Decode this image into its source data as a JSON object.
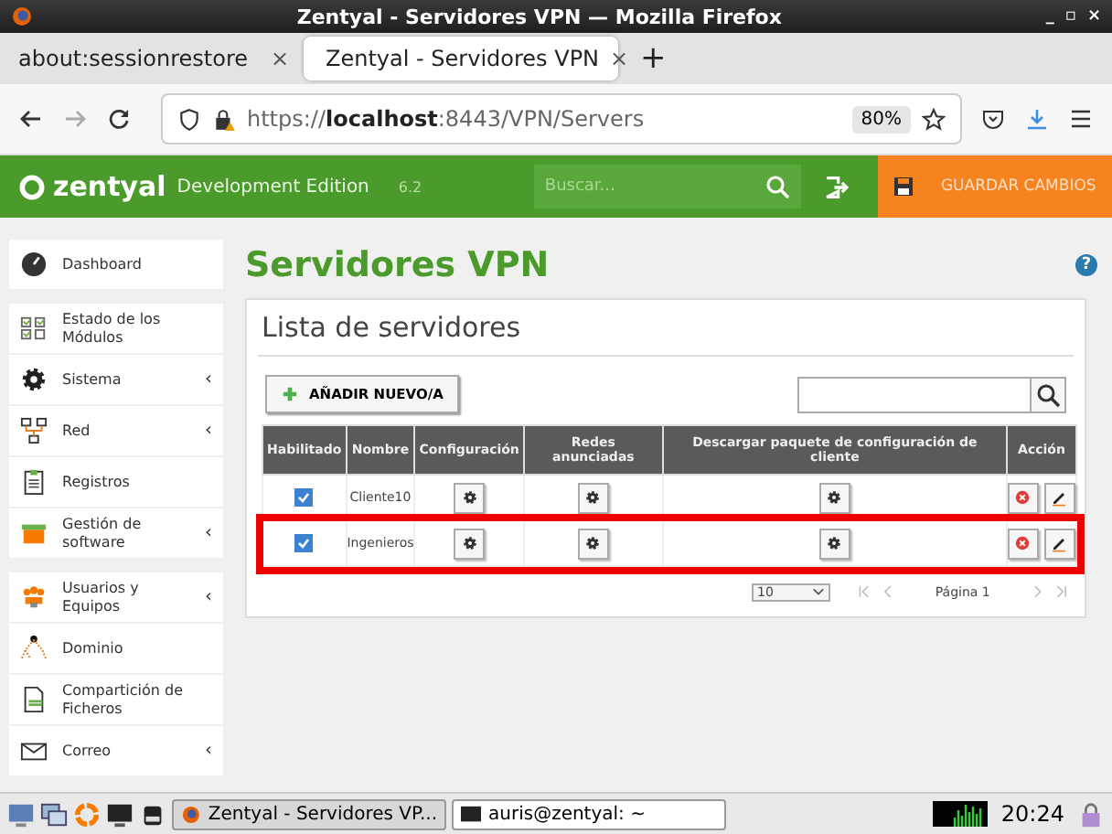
{
  "window": {
    "title": "Zentyal - Servidores VPN — Mozilla Firefox",
    "controls": [
      "_",
      "▫",
      "×"
    ]
  },
  "tabs": [
    {
      "label": "about:sessionrestore",
      "selected": false,
      "close": "×"
    },
    {
      "label": "Zentyal - Servidores VPN",
      "selected": true,
      "close": "×"
    }
  ],
  "new_tab": "+",
  "nav": {
    "url_prefix": "https://",
    "url_host": "localhost",
    "url_rest": ":8443/VPN/Servers",
    "zoom": "80%"
  },
  "header": {
    "logo": "zentyal",
    "edition": "Development Edition",
    "version": "6.2",
    "search_placeholder": "Buscar...",
    "save": "GUARDAR CAMBIOS"
  },
  "sidebar": {
    "groups": [
      [
        {
          "label": "Dashboard",
          "submenu": false
        }
      ],
      [
        {
          "label": "Estado de los Módulos",
          "submenu": false
        },
        {
          "label": "Sistema",
          "submenu": true
        },
        {
          "label": "Red",
          "submenu": true
        },
        {
          "label": "Registros",
          "submenu": false
        },
        {
          "label": "Gestión de software",
          "submenu": true
        }
      ],
      [
        {
          "label": "Usuarios y Equipos",
          "submenu": true
        },
        {
          "label": "Dominio",
          "submenu": false
        },
        {
          "label": "Compartición de Ficheros",
          "submenu": false
        },
        {
          "label": "Correo",
          "submenu": true
        }
      ]
    ],
    "submenu_glyph": "‹"
  },
  "page": {
    "title": "Servidores VPN",
    "help": "?",
    "panel_title": "Lista de servidores",
    "add_button": "AÑADIR NUEVO/A"
  },
  "table": {
    "columns": [
      "Habilitado",
      "Nombre",
      "Configuración",
      "Redes anunciadas",
      "Descargar paquete de configuración de cliente",
      "Acción"
    ],
    "rows": [
      {
        "enabled": true,
        "name": "Cliente10",
        "highlighted": false
      },
      {
        "enabled": true,
        "name": "Ingenieros",
        "highlighted": true
      }
    ]
  },
  "pager": {
    "page_size": "10",
    "page": "Página 1"
  },
  "taskbar": {
    "windows": [
      {
        "label": "Zentyal - Servidores VP...",
        "selected": true
      },
      {
        "label": "auris@zentyal: ~",
        "selected": false
      }
    ],
    "clock": "20:24"
  }
}
